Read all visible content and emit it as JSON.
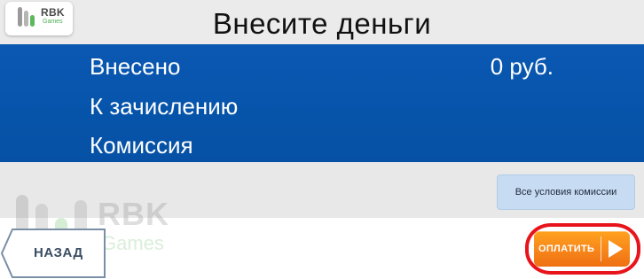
{
  "header": {
    "logo": {
      "name": "RBK",
      "sub": "Games"
    },
    "title": "Внесите деньги"
  },
  "payment_info": {
    "rows": [
      {
        "label": "Внесено",
        "value": "0 руб."
      },
      {
        "label": "К зачислению",
        "value": ""
      },
      {
        "label": "Комиссия",
        "value": ""
      }
    ]
  },
  "conditions": {
    "button_label": "Все условия комиссии"
  },
  "watermark": {
    "name": "RBK",
    "sub": "Games"
  },
  "footer": {
    "back_label": "НАЗАД",
    "pay_label": "ОПЛАТИТЬ"
  },
  "colors": {
    "header_bg": "#ebebeb",
    "panel_blue": "#0654aa",
    "pay_orange": "#f7861a",
    "highlight_red": "#e8141c",
    "conditions_bg": "#c7dcf2"
  },
  "icons": {
    "logo": "rbk-games-logo-icon",
    "play": "play-arrow-icon"
  }
}
